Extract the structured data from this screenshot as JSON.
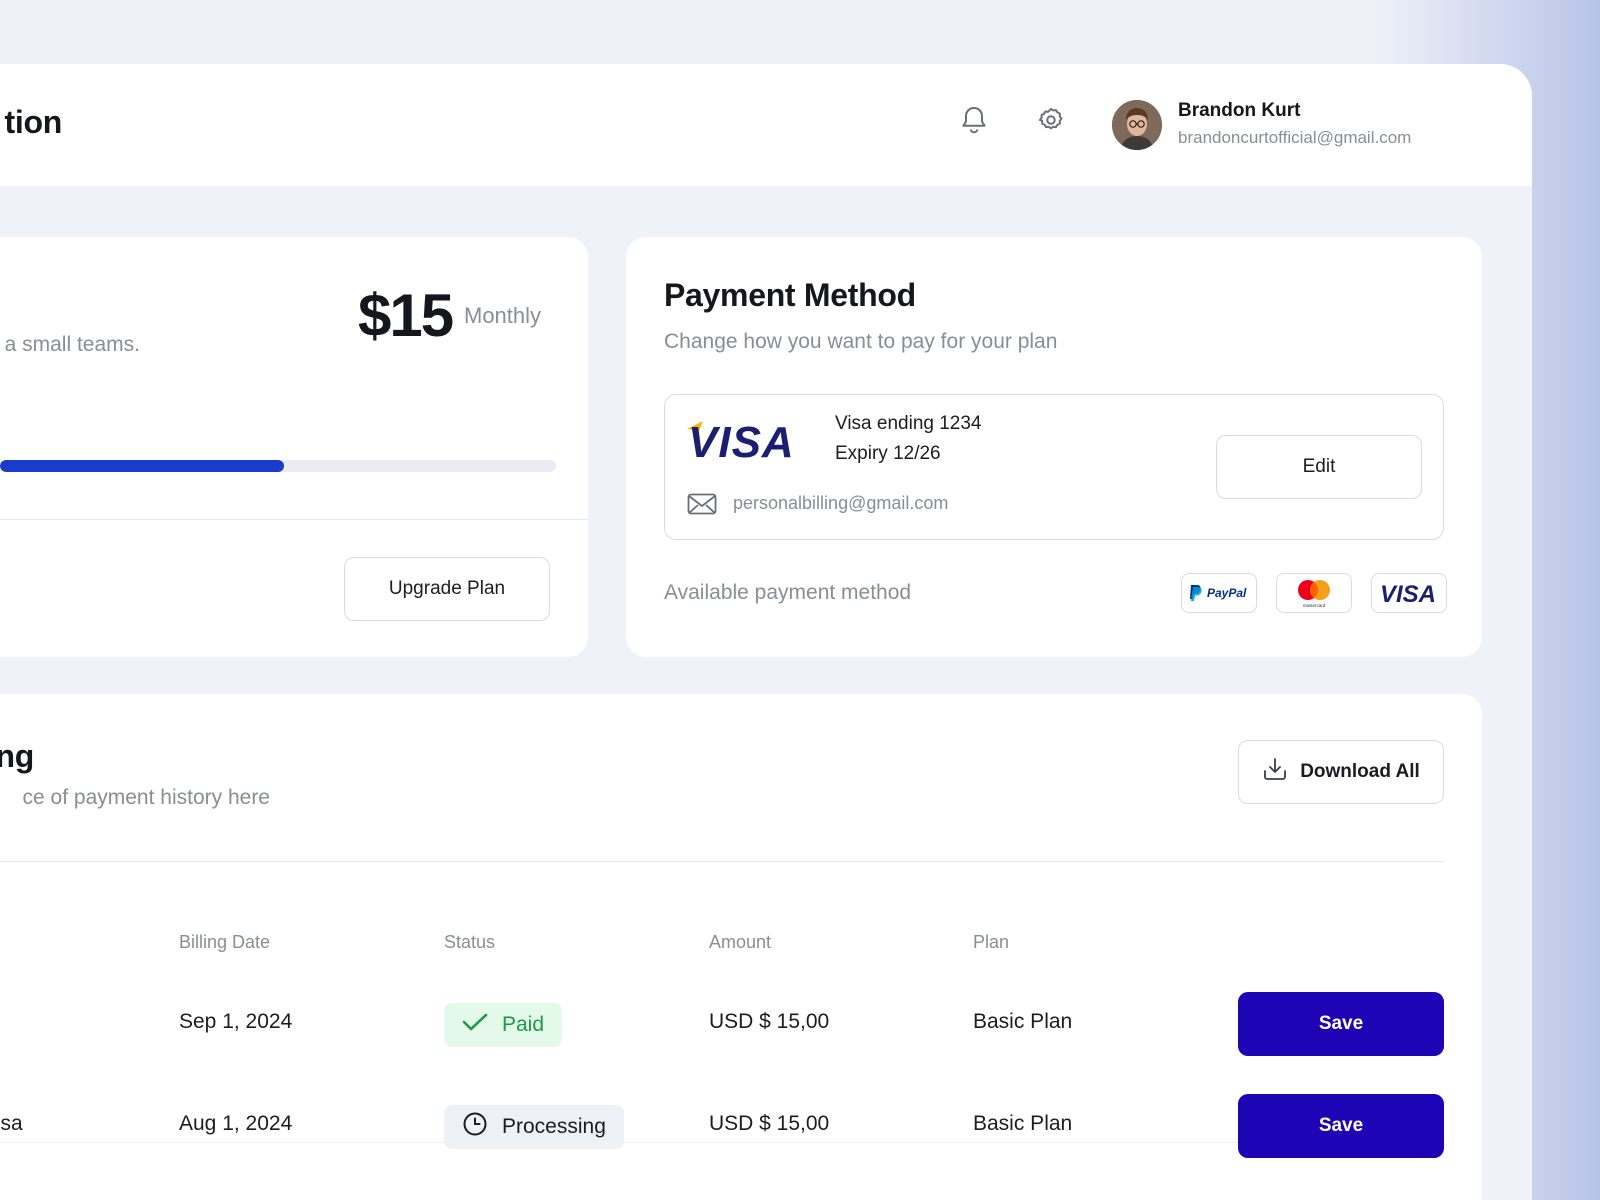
{
  "header": {
    "title": "tion",
    "user": {
      "name": "Brandon Kurt",
      "email": "brandoncurtofficial@gmail.com"
    }
  },
  "plan": {
    "description": "a small teams.",
    "price": "$15",
    "period": "Monthly",
    "usage_fraction": 0.51,
    "upgrade_label": "Upgrade Plan"
  },
  "payment": {
    "title": "Payment Method",
    "subtitle": "Change how you want to pay for your plan",
    "card_brand_text": "VISA",
    "card_ending": "Visa ending 1234",
    "card_expiry": "Expiry 12/26",
    "billing_email": "personalbilling@gmail.com",
    "edit_label": "Edit",
    "available_label": "Available payment method",
    "methods": [
      "PayPal",
      "mastercard",
      "VISA"
    ]
  },
  "invoicing": {
    "title": "icing",
    "subtitle": "ce of payment history here",
    "download_label": "Download All",
    "columns": [
      "Billing Date",
      "Status",
      "Amount",
      "Plan"
    ],
    "rows": [
      {
        "name": "",
        "date": "Sep 1, 2024",
        "status": "Paid",
        "amount": "USD $ 15,00",
        "plan": "Basic Plan",
        "action": "Save"
      },
      {
        "name": "ssa",
        "date": "Aug 1, 2024",
        "status": "Processing",
        "amount": "USD $ 15,00",
        "plan": "Basic Plan",
        "action": "Save"
      }
    ]
  },
  "colors": {
    "accent": "#1d04b5",
    "progress": "#1a3ccc",
    "visa_blue": "#1a1f71",
    "visa_gold": "#f7b600",
    "paid_green": "#1d9b45",
    "paid_bg": "#e4f9e9"
  }
}
